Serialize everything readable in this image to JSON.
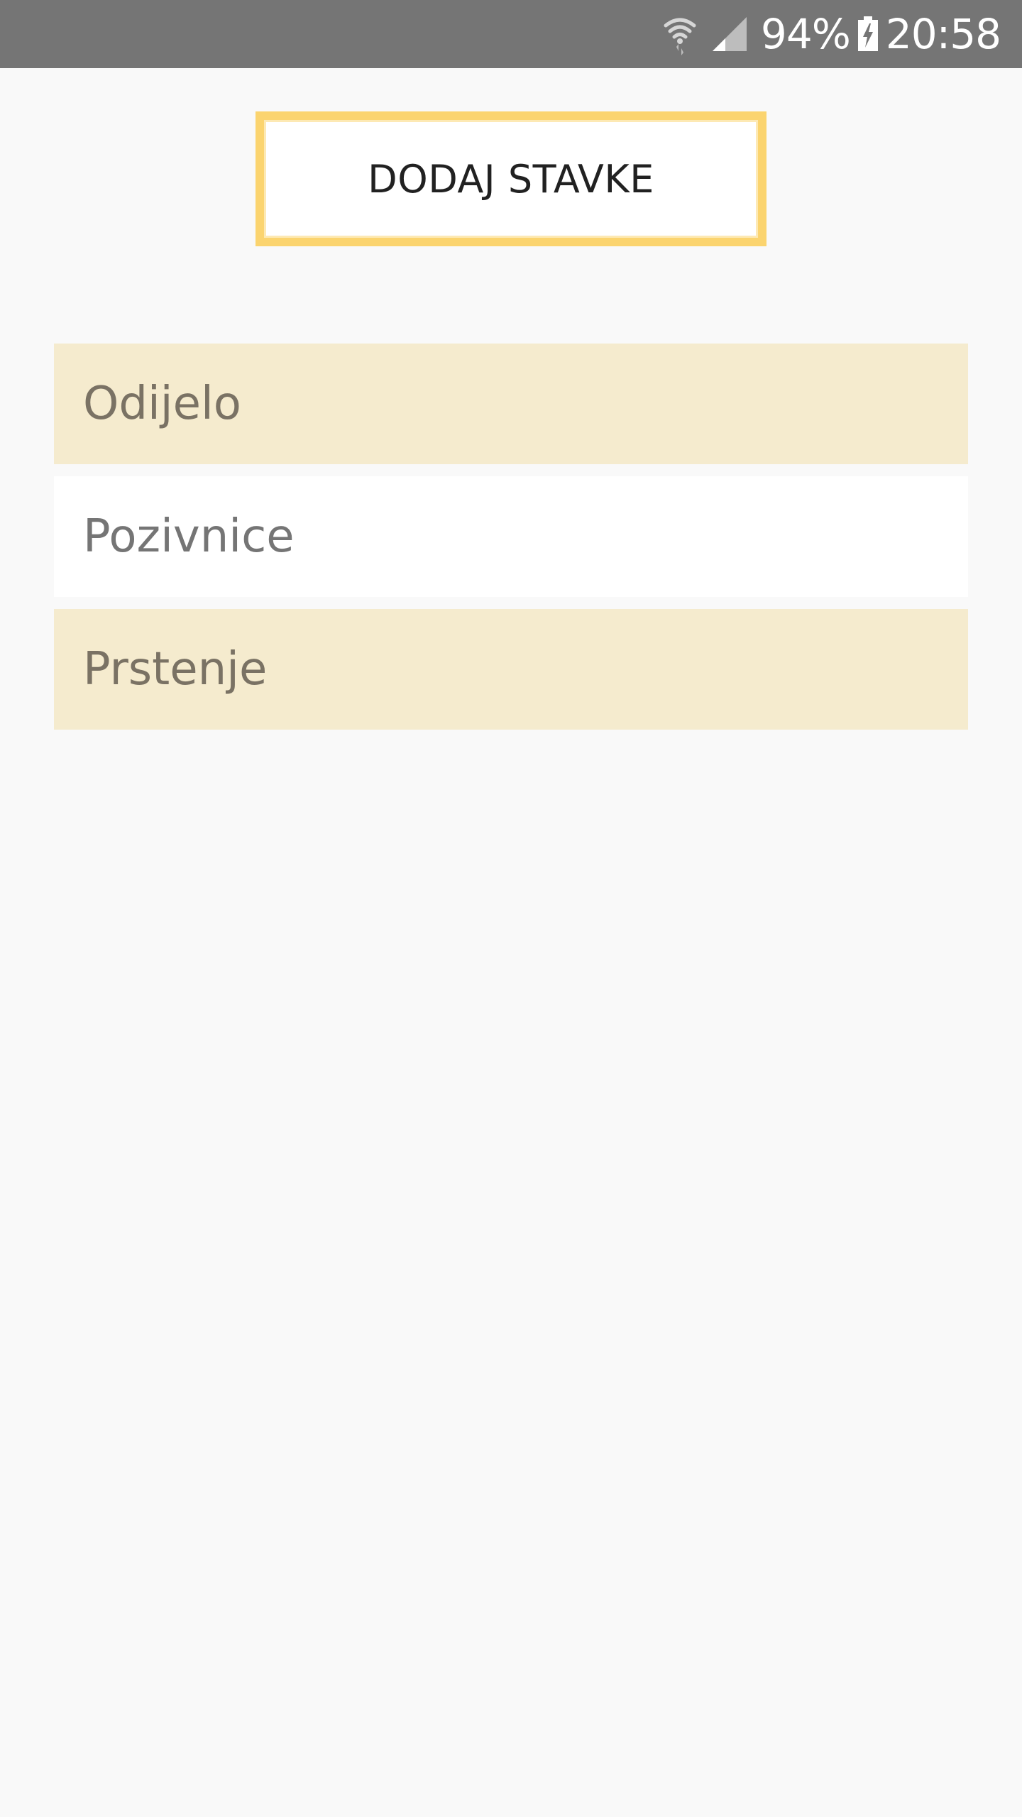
{
  "status_bar": {
    "battery_percent": "94%",
    "time": "20:58",
    "icons": [
      "wifi-icon",
      "signal-icon",
      "battery-charging-icon"
    ]
  },
  "add_button": {
    "label": "DODAJ STAVKE"
  },
  "items": [
    {
      "label": "Odijelo"
    },
    {
      "label": "Pozivnice"
    },
    {
      "label": "Prstenje"
    }
  ],
  "colors": {
    "status_bar": "#757575",
    "background": "#f9f9f9",
    "button_border": "#fbd46f",
    "item_tint": "#f5ebce",
    "item_plain": "#ffffff"
  }
}
